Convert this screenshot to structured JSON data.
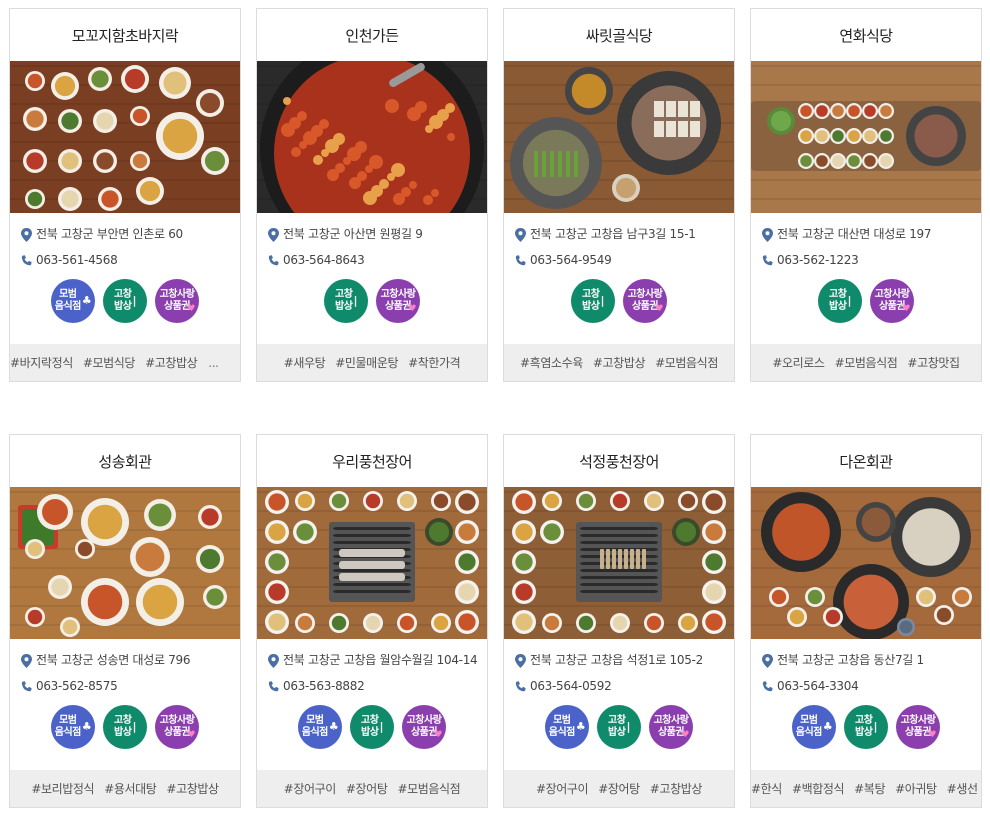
{
  "restaurants": [
    {
      "name": "모꼬지함초바지락",
      "address": "전북 고창군 부안면 인촌로 60",
      "phone": "063-561-4568",
      "badges": [
        "model",
        "bapsang",
        "voucher"
      ],
      "tags": [
        "#바지락정식",
        "#모범식당",
        "#고창밥상"
      ],
      "more": "..."
    },
    {
      "name": "인천가든",
      "address": "전북 고창군 아산면 원평길 9",
      "phone": "063-564-8643",
      "badges": [
        "bapsang",
        "voucher"
      ],
      "tags": [
        "#새우탕",
        "#민물매운탕",
        "#착한가격"
      ]
    },
    {
      "name": "싸릿골식당",
      "address": "전북 고창군 고창읍 남구3길 15-1",
      "phone": "063-564-9549",
      "badges": [
        "bapsang",
        "voucher"
      ],
      "tags": [
        "#흑염소수육",
        "#고창밥상",
        "#모범음식점"
      ]
    },
    {
      "name": "연화식당",
      "address": "전북 고창군 대산면 대성로 197",
      "phone": "063-562-1223",
      "badges": [
        "bapsang",
        "voucher"
      ],
      "tags": [
        "#오리로스",
        "#모범음식점",
        "#고창맛집"
      ]
    },
    {
      "name": "성송회관",
      "address": "전북 고창군 성송면 대성로 796",
      "phone": "063-562-8575",
      "badges": [
        "model",
        "bapsang",
        "voucher"
      ],
      "tags": [
        "#보리밥정식",
        "#용서대탕",
        "#고창밥상"
      ]
    },
    {
      "name": "우리풍천장어",
      "address": "전북 고창군 고창읍 월암수월길 104-14",
      "phone": "063-563-8882",
      "badges": [
        "model",
        "bapsang",
        "voucher"
      ],
      "tags": [
        "#장어구이",
        "#장어탕",
        "#모범음식점"
      ]
    },
    {
      "name": "석정풍천장어",
      "address": "전북 고창군 고창읍 석정1로 105-2",
      "phone": "063-564-0592",
      "badges": [
        "model",
        "bapsang",
        "voucher"
      ],
      "tags": [
        "#장어구이",
        "#장어탕",
        "#고창밥상"
      ]
    },
    {
      "name": "다온회관",
      "address": "전북 고창군 고창읍 동산7길 1",
      "phone": "063-564-3304",
      "badges": [
        "model",
        "bapsang",
        "voucher"
      ],
      "tags": [
        "#한식",
        "#백합정식",
        "#복탕",
        "#아귀탕",
        "#생선"
      ],
      "more": "..."
    }
  ],
  "badge_labels": {
    "model": [
      "모범",
      "음식점"
    ],
    "bapsang": [
      "고창",
      "밥상"
    ],
    "voucher": [
      "고창사랑",
      "상품권"
    ]
  },
  "colors": {
    "model": "#4b63c9",
    "bapsang": "#0f8a6b",
    "voucher": "#8b3fae",
    "icon": "#4a6fa5",
    "tag_bar": "#eeeeee"
  },
  "icons": {
    "address": "map-pin-icon",
    "phone": "phone-icon"
  }
}
